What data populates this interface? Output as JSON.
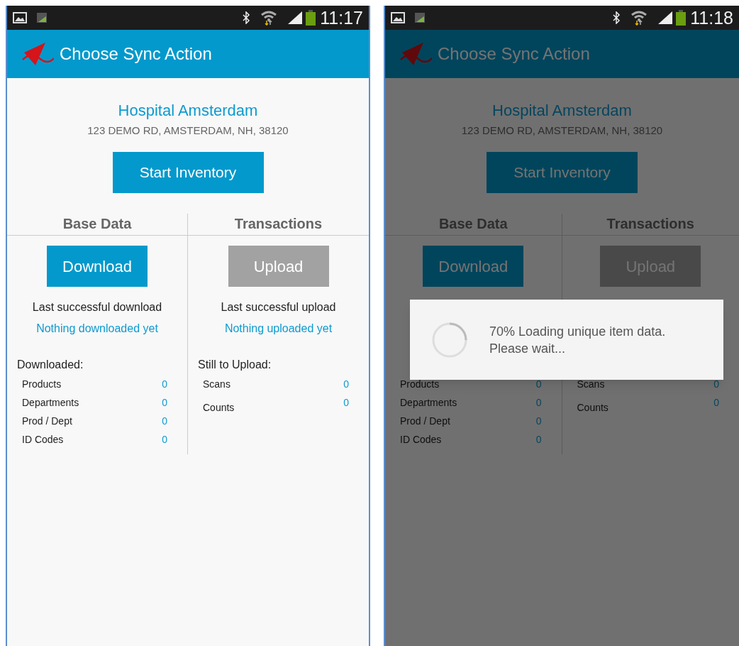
{
  "screens": [
    {
      "status_bar": {
        "time": "11:17"
      },
      "title": "Choose Sync Action",
      "hospital_name": "Hospital Amsterdam",
      "address": "123 DEMO RD, AMSTERDAM, NH, 38120",
      "start_button": "Start Inventory",
      "sections": [
        {
          "heading": "Base Data",
          "button": {
            "label": "Download",
            "disabled": false
          },
          "last_label": "Last successful download",
          "last_value": "Nothing downloaded yet",
          "list_heading": "Downloaded:",
          "items": [
            {
              "label": "Products",
              "value": "0"
            },
            {
              "label": "Departments",
              "value": "0"
            },
            {
              "label": "Prod / Dept",
              "value": "0"
            },
            {
              "label": "ID Codes",
              "value": "0"
            }
          ]
        },
        {
          "heading": "Transactions",
          "button": {
            "label": "Upload",
            "disabled": true
          },
          "last_label": "Last successful upload",
          "last_value": "Nothing uploaded yet",
          "list_heading": "Still to Upload:",
          "items": [
            {
              "label": "Scans",
              "value": "0"
            },
            {
              "label": "Counts",
              "value": "0"
            }
          ]
        }
      ]
    },
    {
      "status_bar": {
        "time": "11:18"
      },
      "title": "Choose Sync Action",
      "hospital_name": "Hospital Amsterdam",
      "address": "123 DEMO RD, AMSTERDAM, NH, 38120",
      "start_button": "Start Inventory",
      "sections": [
        {
          "heading": "Base Data",
          "button": {
            "label": "Download",
            "disabled": false
          },
          "items": [
            {
              "label": "Products",
              "value": "0"
            },
            {
              "label": "Departments",
              "value": "0"
            },
            {
              "label": "Prod / Dept",
              "value": "0"
            },
            {
              "label": "ID Codes",
              "value": "0"
            }
          ]
        },
        {
          "heading": "Transactions",
          "button": {
            "label": "Upload",
            "disabled": true
          },
          "items": [
            {
              "label": "Scans",
              "value": "0"
            },
            {
              "label": "Counts",
              "value": "0"
            }
          ]
        }
      ],
      "dialog": {
        "message": "70% Loading unique item data.\nPlease wait..."
      }
    }
  ]
}
